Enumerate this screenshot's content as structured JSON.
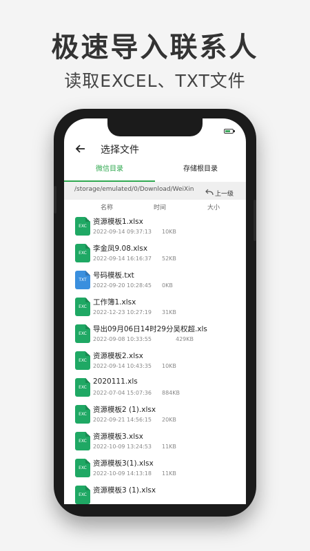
{
  "promo": {
    "headline": "极速导入联系人",
    "subline": "读取EXCEL、TXT文件"
  },
  "appbar": {
    "title": "选择文件"
  },
  "tabs": [
    {
      "label": "微信目录",
      "active": true
    },
    {
      "label": "存储根目录",
      "active": false
    }
  ],
  "path": {
    "text": "/storage/emulated/0/Download/WeiXin",
    "up_label": "上一级"
  },
  "columns": {
    "name": "名称",
    "time": "时间",
    "size": "大小"
  },
  "files": [
    {
      "name": "资源模板1.xlsx",
      "date": "2022-09-14 09:37:13",
      "size": "10KB",
      "type": "EXC"
    },
    {
      "name": "李金凤9.08.xlsx",
      "date": "2022-09-14 16:16:37",
      "size": "52KB",
      "type": "EXC"
    },
    {
      "name": "号码模板.txt",
      "date": "2022-09-20 10:28:45",
      "size": "0KB",
      "type": "TXT"
    },
    {
      "name": "工作簿1.xlsx",
      "date": "2022-12-23 10:27:19",
      "size": "31KB",
      "type": "EXC"
    },
    {
      "name": "导出09月06日14时29分吴权超.xls",
      "date": "2022-09-08 10:33:55",
      "size": "429KB",
      "type": "EXC"
    },
    {
      "name": "资源模板2.xlsx",
      "date": "2022-09-14 10:43:35",
      "size": "10KB",
      "type": "EXC"
    },
    {
      "name": "2020111.xls",
      "date": "2022-07-04 15:07:36",
      "size": "884KB",
      "type": "EXC"
    },
    {
      "name": "资源模板2 (1).xlsx",
      "date": "2022-09-21 14:56:15",
      "size": "20KB",
      "type": "EXC"
    },
    {
      "name": "资源模板3.xlsx",
      "date": "2022-10-09 13:24:53",
      "size": "11KB",
      "type": "EXC"
    },
    {
      "name": "资源模板3(1).xlsx",
      "date": "2022-10-09 14:13:18",
      "size": "11KB",
      "type": "EXC"
    },
    {
      "name": "资源模板3 (1).xlsx",
      "date": "",
      "size": "",
      "type": "EXC"
    }
  ],
  "colors": {
    "accent": "#2fa84f",
    "excel_icon": "#1fa864",
    "txt_icon": "#3a8fde"
  },
  "icons": {
    "back": "arrow-left-icon",
    "up": "return-arrow-icon",
    "battery": "battery-icon"
  }
}
